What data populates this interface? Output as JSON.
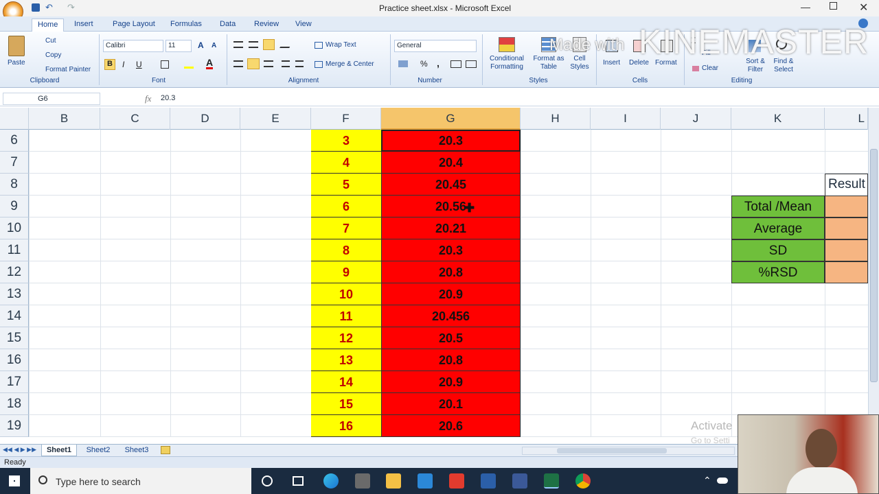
{
  "window": {
    "title": "Practice sheet.xlsx - Microsoft Excel"
  },
  "ribbon_tabs": [
    "Home",
    "Insert",
    "Page Layout",
    "Formulas",
    "Data",
    "Review",
    "View"
  ],
  "clipboard": {
    "paste": "Paste",
    "cut": "Cut",
    "copy": "Copy",
    "format_painter": "Format Painter",
    "label": "Clipboard"
  },
  "font": {
    "name": "Calibri",
    "size": "11",
    "label": "Font",
    "bold": "B",
    "italic": "I",
    "underline": "U"
  },
  "alignment": {
    "wrap": "Wrap Text",
    "merge": "Merge & Center",
    "label": "Alignment"
  },
  "number": {
    "format": "General",
    "label": "Number",
    "percent": "%"
  },
  "styles": {
    "conditional": "Conditional Formatting",
    "format_table": "Format as Table",
    "cell_styles": "Cell Styles",
    "label": "Styles"
  },
  "cells": {
    "insert": "Insert",
    "delete": "Delete",
    "format": "Format",
    "label": "Cells"
  },
  "editing": {
    "clear": "Clear",
    "fill": "Fill",
    "sort": "Sort & Filter",
    "find": "Find & Select",
    "label": "Editing"
  },
  "watermark": {
    "made_with": "Made with",
    "brand": "KINEMASTER"
  },
  "formula_bar": {
    "name_box": "G6",
    "fx": "fx",
    "value": "20.3"
  },
  "columns": [
    "B",
    "C",
    "D",
    "E",
    "F",
    "G",
    "H",
    "I",
    "J",
    "K",
    "L"
  ],
  "rows": [
    "6",
    "7",
    "8",
    "9",
    "10",
    "11",
    "12",
    "13",
    "14",
    "15",
    "16",
    "17",
    "18",
    "19"
  ],
  "col_f": [
    "3",
    "4",
    "5",
    "6",
    "7",
    "8",
    "9",
    "10",
    "11",
    "12",
    "13",
    "14",
    "15",
    "16"
  ],
  "col_g": [
    "20.3",
    "20.4",
    "20.45",
    "20.56",
    "20.21",
    "20.3",
    "20.8",
    "20.9",
    "20.456",
    "20.5",
    "20.8",
    "20.9",
    "20.1",
    "20.6"
  ],
  "stats": {
    "header": "Result",
    "labels": [
      "Total /Mean",
      "Average",
      "SD",
      "%RSD"
    ]
  },
  "sheets": [
    "Sheet1",
    "Sheet2",
    "Sheet3"
  ],
  "status": {
    "ready": "Ready",
    "activate": "Activate",
    "goto": "Go to Setti"
  },
  "taskbar": {
    "search_placeholder": "Type here to search"
  },
  "colors": {
    "yellow": "#ffff00",
    "red": "#ff0000",
    "green": "#6fbf3b",
    "orange": "#f6b582",
    "selected_col": "#f5c56b"
  }
}
